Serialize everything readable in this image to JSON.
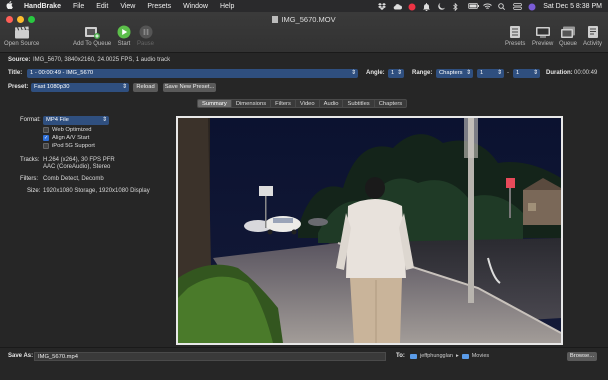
{
  "menubar": {
    "app_name": "HandBrake",
    "items": [
      "File",
      "Edit",
      "View",
      "Presets",
      "Window",
      "Help"
    ],
    "clock": "Sat Dec 5  8:38 PM"
  },
  "window": {
    "title": "IMG_5670.MOV"
  },
  "toolbar": {
    "open_source": "Open Source",
    "add_to_queue": "Add To Queue",
    "start": "Start",
    "pause": "Pause",
    "presets": "Presets",
    "preview": "Preview",
    "queue": "Queue",
    "activity": "Activity"
  },
  "source": {
    "label": "Source:",
    "value": "IMG_5670, 3840x2160, 24.0025 FPS, 1 audio track"
  },
  "title_row": {
    "label": "Title:",
    "value": "1 - 00:00:49 - IMG_5670",
    "angle_label": "Angle:",
    "angle_value": "1",
    "range_label": "Range:",
    "range_value": "Chapters",
    "range_from": "1",
    "range_dash": "-",
    "range_to": "1",
    "duration_label": "Duration:",
    "duration_value": "00:00:49"
  },
  "preset_row": {
    "label": "Preset:",
    "value": "Fast 1080p30",
    "reload": "Reload",
    "save_new": "Save New Preset..."
  },
  "tabs": [
    "Summary",
    "Dimensions",
    "Filters",
    "Video",
    "Audio",
    "Subtitles",
    "Chapters"
  ],
  "summary": {
    "format_label": "Format:",
    "format_value": "MP4 File",
    "web_optimized": "Web Optimized",
    "align_av": "Align A/V Start",
    "ipod": "iPod 5G Support",
    "tracks_label": "Tracks:",
    "tracks_line1": "H.264 (x264), 30 FPS PFR",
    "tracks_line2": "AAC (CoreAudio), Stereo",
    "filters_label": "Filters:",
    "filters_value": "Comb Detect, Decomb",
    "size_label": "Size:",
    "size_value": "1920x1080 Storage, 1920x1080 Display"
  },
  "bottom": {
    "save_as_label": "Save As:",
    "save_as_value": "IMG_5670.mp4",
    "to_label": "To:",
    "path_user": "jeffphungglan",
    "path_sep": "▸",
    "path_folder": "Movies",
    "browse": "Browse..."
  },
  "colors": {
    "accent": "#2f4f7f",
    "checkbox_on": "#2f6fd6"
  }
}
